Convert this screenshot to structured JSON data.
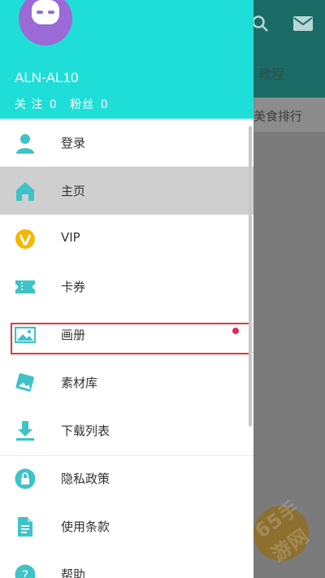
{
  "background": {
    "tab_label": "教程",
    "strip_label": "美食排行",
    "watermark": "65手游网"
  },
  "header": {
    "device_name": "ALN-AL10",
    "follow_label": "关 注",
    "follow_count": "0",
    "fans_label": "粉丝",
    "fans_count": "0"
  },
  "menu": {
    "items": [
      {
        "label": "登录",
        "icon": "person-icon"
      },
      {
        "label": "主页",
        "icon": "home-icon",
        "active": true
      },
      {
        "label": "VIP",
        "icon": "vip-icon"
      },
      {
        "label": "卡券",
        "icon": "ticket-icon"
      },
      {
        "label": "画册",
        "icon": "picture-icon",
        "badge": true
      },
      {
        "label": "素材库",
        "icon": "gallery-icon"
      },
      {
        "label": "下载列表",
        "icon": "download-icon"
      },
      {
        "label": "隐私政策",
        "icon": "lock-icon"
      },
      {
        "label": "使用条款",
        "icon": "document-icon"
      },
      {
        "label": "帮助",
        "icon": "help-icon"
      }
    ]
  },
  "colors": {
    "header_bg": "#1fded7",
    "accent": "#3ec3c7",
    "badge": "#e8245a",
    "vip": "#f5b800"
  }
}
